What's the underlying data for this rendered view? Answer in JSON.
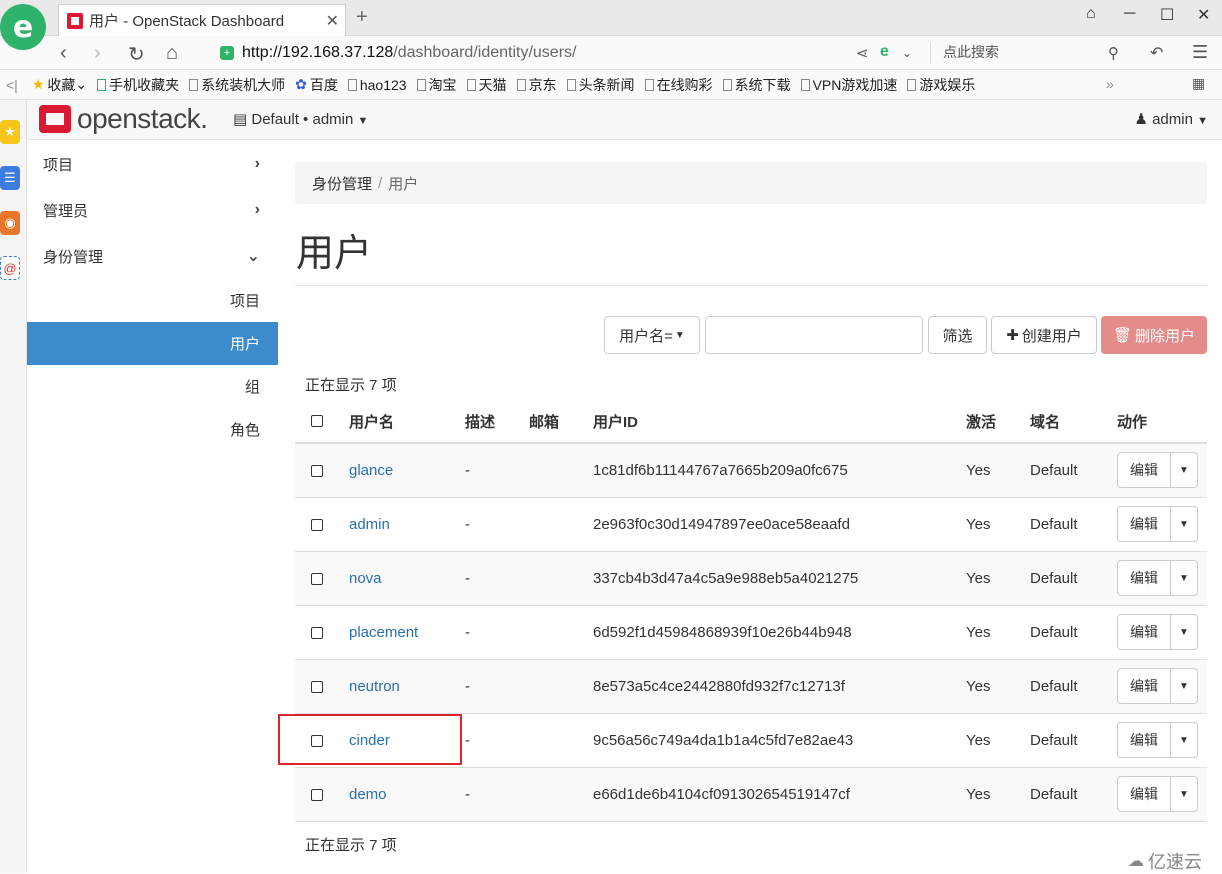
{
  "browser": {
    "tab_title": "用户 - OpenStack Dashboard",
    "tab_close": "✕",
    "new_tab": "+",
    "url_host": "http://192.168.37.128",
    "url_path": "/dashboard/identity/users/",
    "search_placeholder": "点此搜索",
    "bookmarks": [
      {
        "label": "收藏",
        "icon": "star-icon"
      },
      {
        "label": "手机收藏夹",
        "icon": "phone-icon"
      },
      {
        "label": "系统装机大师",
        "icon": "doc-icon"
      },
      {
        "label": "百度",
        "icon": "baidu-icon"
      },
      {
        "label": "hao123",
        "icon": "doc-icon"
      },
      {
        "label": "淘宝",
        "icon": "doc-icon"
      },
      {
        "label": "天猫",
        "icon": "doc-icon"
      },
      {
        "label": "京东",
        "icon": "doc-icon"
      },
      {
        "label": "头条新闻",
        "icon": "doc-icon"
      },
      {
        "label": "在线购彩",
        "icon": "doc-icon"
      },
      {
        "label": "系统下载",
        "icon": "doc-icon"
      },
      {
        "label": "VPN游戏加速",
        "icon": "doc-icon"
      },
      {
        "label": "游戏娱乐",
        "icon": "doc-icon"
      }
    ],
    "bookmarks_more": "»"
  },
  "header": {
    "logo_text": "openstack.",
    "project_select": "Default • admin",
    "user_menu": "admin"
  },
  "sidebar": {
    "items": [
      {
        "label": "项目",
        "chevron": "›"
      },
      {
        "label": "管理员",
        "chevron": "›"
      },
      {
        "label": "身份管理",
        "chevron": "⌄"
      }
    ],
    "subitems": [
      {
        "label": "项目"
      },
      {
        "label": "用户"
      },
      {
        "label": "组"
      },
      {
        "label": "角色"
      }
    ]
  },
  "main": {
    "breadcrumb": [
      "身份管理",
      "用户"
    ],
    "page_title": "用户",
    "filter_select": "用户名=",
    "filter_input_value": "",
    "filter_button": "筛选",
    "create_button": "创建用户",
    "delete_button": "删除用户",
    "count_text": "正在显示 7 项"
  },
  "table": {
    "columns": [
      "用户名",
      "描述",
      "邮箱",
      "用户ID",
      "激活",
      "域名",
      "动作"
    ],
    "edit_label": "编辑",
    "rows": [
      {
        "name": "glance",
        "desc": "-",
        "email": "",
        "id": "1c81df6b11144767a7665b209a0fc675",
        "enabled": "Yes",
        "domain": "Default"
      },
      {
        "name": "admin",
        "desc": "-",
        "email": "",
        "id": "2e963f0c30d14947897ee0ace58eaafd",
        "enabled": "Yes",
        "domain": "Default"
      },
      {
        "name": "nova",
        "desc": "-",
        "email": "",
        "id": "337cb4b3d47a4c5a9e988eb5a4021275",
        "enabled": "Yes",
        "domain": "Default"
      },
      {
        "name": "placement",
        "desc": "-",
        "email": "",
        "id": "6d592f1d45984868939f10e26b44b948",
        "enabled": "Yes",
        "domain": "Default"
      },
      {
        "name": "neutron",
        "desc": "-",
        "email": "",
        "id": "8e573a5c4ce2442880fd932f7c12713f",
        "enabled": "Yes",
        "domain": "Default"
      },
      {
        "name": "cinder",
        "desc": "-",
        "email": "",
        "id": "9c56a56c749a4da1b1a4c5fd7e82ae43",
        "enabled": "Yes",
        "domain": "Default"
      },
      {
        "name": "demo",
        "desc": "-",
        "email": "",
        "id": "e66d1de6b4104cf091302654519147cf",
        "enabled": "Yes",
        "domain": "Default"
      }
    ]
  },
  "watermark": "亿速云",
  "colors": {
    "accent": "#3d8bcd",
    "brand": "#da1a32",
    "delete": "#e48c8a",
    "link": "#2a6fb0",
    "highlight": "#d9262b"
  }
}
